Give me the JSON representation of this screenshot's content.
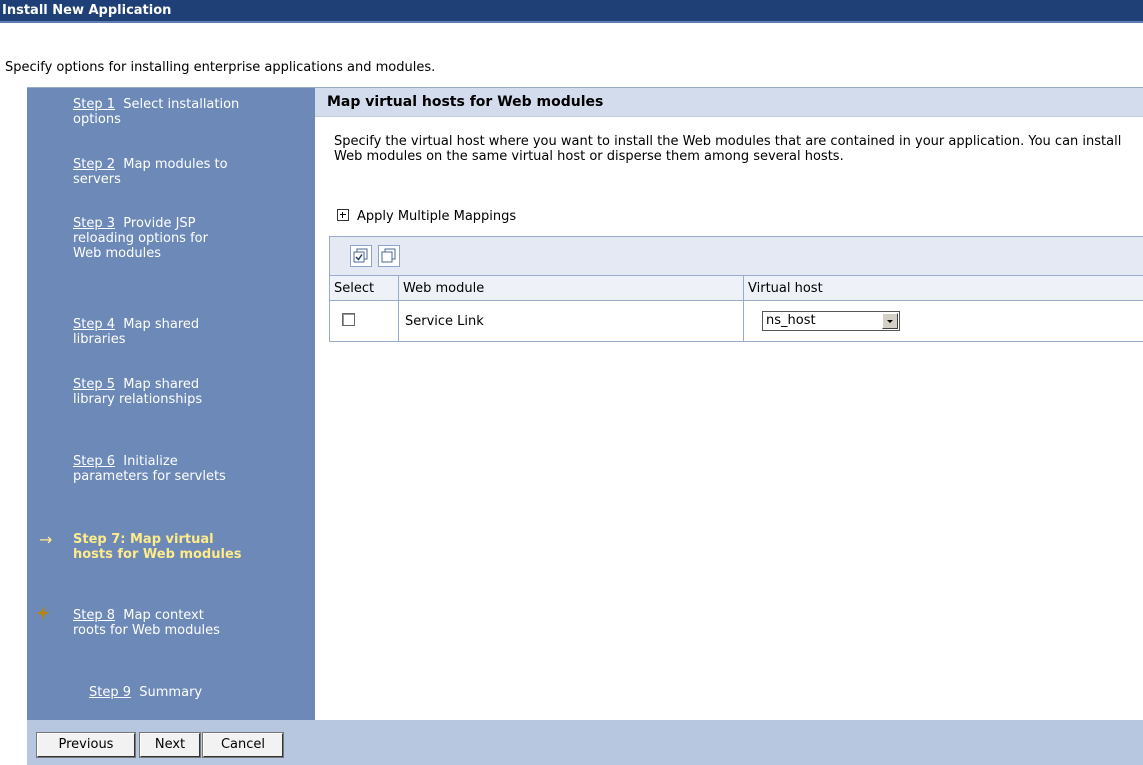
{
  "window": {
    "title": "Install New Application"
  },
  "intro": "Specify options for installing enterprise applications and modules.",
  "steps": [
    {
      "link": "Step 1",
      "text": "Select installation options"
    },
    {
      "link": "Step 2",
      "text": "Map modules to servers"
    },
    {
      "link": "Step 3",
      "text": "Provide JSP reloading options for Web modules"
    },
    {
      "link": "Step 4",
      "text": "Map shared libraries"
    },
    {
      "link": "Step 5",
      "text": "Map shared library relationships"
    },
    {
      "link": "Step 6",
      "text": "Initialize parameters for servlets"
    },
    {
      "text": "Step 7: Map virtual hosts for Web modules",
      "current": true
    },
    {
      "link": "Step 8",
      "text": "Map context roots for Web modules"
    },
    {
      "link": "Step 9",
      "text": "Summary"
    }
  ],
  "content": {
    "header": "Map virtual hosts for Web modules",
    "description": "Specify the virtual host where you want to install the Web modules that are contained in your application. You can install Web modules on the same virtual host or disperse them among several hosts.",
    "apply_multiple": "Apply Multiple Mappings"
  },
  "table": {
    "columns": [
      "Select",
      "Web module",
      "Virtual host"
    ],
    "rows": [
      {
        "module": "Service Link",
        "virtual_host": "ns_host"
      }
    ]
  },
  "buttons": {
    "previous": "Previous",
    "next": "Next",
    "cancel": "Cancel"
  }
}
